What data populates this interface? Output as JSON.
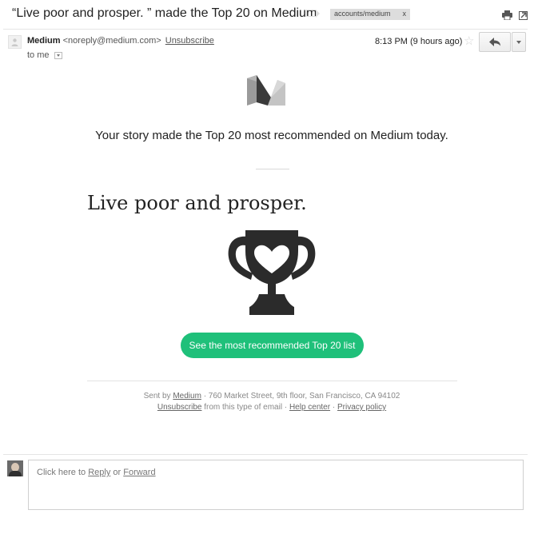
{
  "email": {
    "subject": "“Live poor and prosper. ” made the Top 20 on Medium",
    "label": "accounts/medium",
    "label_remove": "x",
    "icons": {
      "important": "important-marker-icon",
      "print": "print-icon",
      "new_window": "new-window-icon",
      "star": "star-icon",
      "reply": "reply-arrow-icon",
      "more": "chevron-down-icon"
    },
    "sender": {
      "name": "Medium",
      "address": "<noreply@medium.com>",
      "unsubscribe": "Unsubscribe",
      "to": "to me",
      "time": "8:13 PM (9 hours ago)"
    }
  },
  "body": {
    "logo": "medium-logo",
    "headline": "Your story made the Top 20 most recommended on Medium today.",
    "story_title": "Live poor and prosper.",
    "trophy": "trophy-heart-icon",
    "cta": "See the most recommended Top 20 list",
    "cta_color": "#1fc07a",
    "footer": {
      "sent_by": "Sent by",
      "medium_link": "Medium",
      "address": "· 760 Market Street, 9th floor, San Francisco, CA 94102",
      "unsubscribe": "Unsubscribe",
      "from_type": "from this type of email ·",
      "help": "Help center",
      "sep": "·",
      "privacy": "Privacy policy"
    }
  },
  "reply": {
    "click_here": "Click here to",
    "reply_link": "Reply",
    "or": "or",
    "forward_link": "Forward"
  }
}
